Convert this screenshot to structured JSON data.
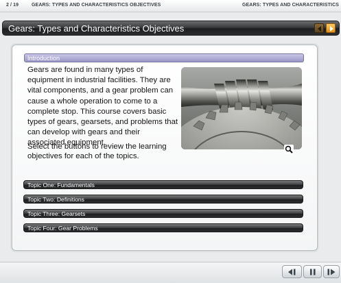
{
  "header": {
    "page_indicator": "2 / 19",
    "course_title_left": "GEARS: TYPES AND CHARACTERISTICS OBJECTIVES",
    "course_title_right": "GEARS: TYPES AND CHARACTERISTICS"
  },
  "title_bar": {
    "title": "Gears: Types and Characteristics Objectives",
    "prev_icon": "chevron-left-icon",
    "next_icon": "chevron-right-icon"
  },
  "content": {
    "section_label": "Introduction",
    "intro_paragraph": "Gears are found in many types of equipment in industrial facilities. They are vital components, and a gear problem can cause a whole operation to come to a complete stop. This course covers basic types of gears, gearsets, and problems that can develop with gears and their associated equipment.",
    "instruction": "Select the buttons to review the learning objectives for each of the topics.",
    "image_icon": "zoom-icon"
  },
  "topics": [
    {
      "label": "Topic One: Fundamentals"
    },
    {
      "label": "Topic Two: Definitions"
    },
    {
      "label": "Topic Three: Gearsets"
    },
    {
      "label": "Topic Four: Gear Problems"
    }
  ],
  "controls": {
    "back_icon": "rewind-icon",
    "pause_icon": "pause-icon",
    "forward_icon": "fast-forward-icon"
  },
  "colors": {
    "accent_orange": "#f0a028",
    "intro_bar": "#aaa6d4",
    "topic_button": "#2c2d2e",
    "background": "#e9ebec"
  }
}
